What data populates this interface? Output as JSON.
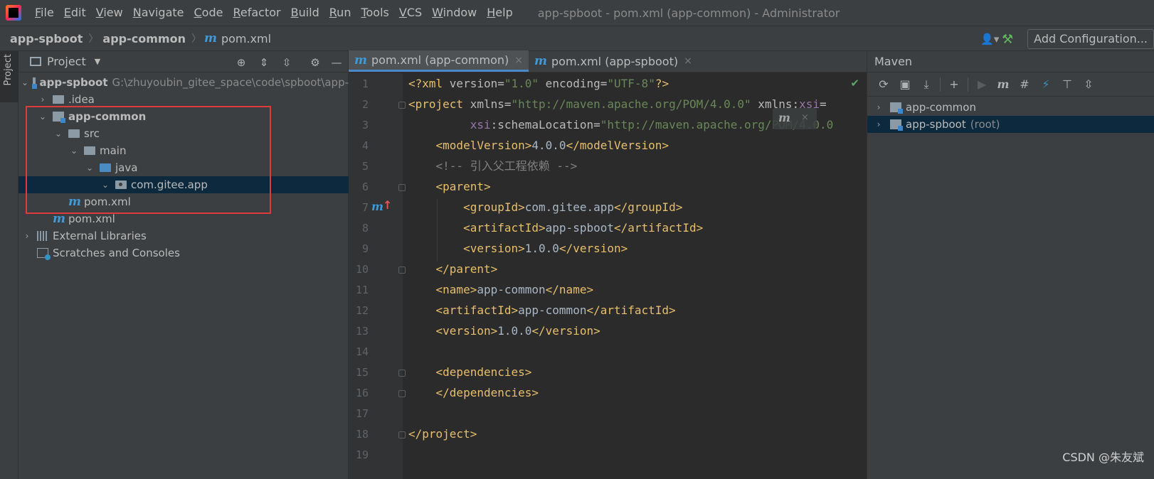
{
  "window": {
    "title": "app-spboot - pom.xml (app-common) - Administrator"
  },
  "menu": [
    "File",
    "Edit",
    "View",
    "Navigate",
    "Code",
    "Refactor",
    "Build",
    "Run",
    "Tools",
    "VCS",
    "Window",
    "Help"
  ],
  "breadcrumb": {
    "project": "app-spboot",
    "module": "app-common",
    "file": "pom.xml",
    "sep": "〉"
  },
  "toolbar": {
    "add_configuration": "Add Configuration..."
  },
  "left_strip": {
    "project_tab": "Project"
  },
  "project_panel": {
    "title": "Project",
    "tree": [
      {
        "label": "app-spboot",
        "path": "G:\\zhuyoubin_gitee_space\\code\\spboot\\app-"
      },
      {
        "label": ".idea"
      },
      {
        "label": "app-common"
      },
      {
        "label": "src"
      },
      {
        "label": "main"
      },
      {
        "label": "java"
      },
      {
        "label": "com.gitee.app"
      },
      {
        "label": "pom.xml"
      },
      {
        "label": "pom.xml"
      },
      {
        "label": "External Libraries"
      },
      {
        "label": "Scratches and Consoles"
      }
    ]
  },
  "editor": {
    "tabs": [
      {
        "label": "pom.xml (app-common)",
        "active": true
      },
      {
        "label": "pom.xml (app-spboot)",
        "active": false
      }
    ],
    "line_numbers": [
      "1",
      "2",
      "3",
      "4",
      "5",
      "6",
      "7",
      "8",
      "9",
      "10",
      "11",
      "12",
      "13",
      "14",
      "15",
      "16",
      "17",
      "18",
      "19"
    ],
    "code": {
      "l1": {
        "a": "<?xml ",
        "b": "version",
        "c": "=",
        "d": "\"1.0\"",
        "e": " encoding",
        "f": "=",
        "g": "\"UTF-8\"",
        "h": "?>"
      },
      "l2": {
        "a": "<project ",
        "b": "xmlns",
        "c": "=",
        "d": "\"http://maven.apache.org/POM/4.0.0\"",
        "e": " xmlns:",
        "f": "xsi",
        "g": "="
      },
      "l3": {
        "a": "         ",
        "b": "xsi",
        "c": ":schemaLocation",
        "d": "=",
        "e": "\"http://maven.apache.org/POM/4.0.0"
      },
      "l4": {
        "a": "    <modelVersion>",
        "b": "4.0.0",
        "c": "</modelVersion>"
      },
      "l5": {
        "a": "    <!-- 引入父工程依赖 -->"
      },
      "l6": {
        "a": "    <parent>"
      },
      "l7": {
        "a": "        <groupId>",
        "b": "com.gitee.app",
        "c": "</groupId>"
      },
      "l8": {
        "a": "        <artifactId>",
        "b": "app-spboot",
        "c": "</artifactId>"
      },
      "l9": {
        "a": "        <version>",
        "b": "1.0.0",
        "c": "</version>"
      },
      "l10": {
        "a": "    </parent>"
      },
      "l11": {
        "a": "    <name>",
        "b": "app-common",
        "c": "</name>"
      },
      "l12": {
        "a": "    <artifactId>",
        "b": "app-common",
        "c": "</artifactId>"
      },
      "l13": {
        "a": "    <version>",
        "b": "1.0.0",
        "c": "</version>"
      },
      "l15": {
        "a": "    <dependencies>"
      },
      "l16": {
        "a": "    </dependencies>"
      },
      "l18": {
        "a": "</project>"
      }
    }
  },
  "maven_panel": {
    "title": "Maven",
    "items": [
      {
        "label": "app-common"
      },
      {
        "label": "app-spboot",
        "suffix": "(root)"
      }
    ]
  },
  "icons": {
    "m": "m",
    "check": "✔",
    "close": "×"
  },
  "watermark": "CSDN @朱友斌"
}
